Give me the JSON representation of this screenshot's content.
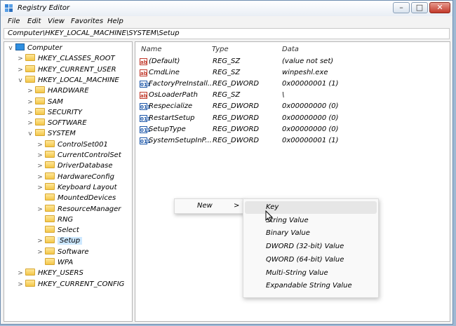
{
  "window": {
    "title": "Registry Editor"
  },
  "controls": {
    "minimize": "–",
    "maximize": "□",
    "close": "✕"
  },
  "menu": [
    "File",
    "Edit",
    "View",
    "Favorites",
    "Help"
  ],
  "address": "Computer\\HKEY_LOCAL_MACHINE\\SYSTEM\\Setup",
  "tree": [
    {
      "label": "Computer",
      "chevron": "v"
    },
    {
      "label": "HKEY_CLASSES_ROOT",
      "chevron": ">"
    },
    {
      "label": "HKEY_CURRENT_USER",
      "chevron": ">"
    },
    {
      "label": "HKEY_LOCAL_MACHINE",
      "chevron": "v"
    },
    {
      "label": "HARDWARE",
      "chevron": ">"
    },
    {
      "label": "SAM",
      "chevron": ">"
    },
    {
      "label": "SECURITY",
      "chevron": ">"
    },
    {
      "label": "SOFTWARE",
      "chevron": ">"
    },
    {
      "label": "SYSTEM",
      "chevron": "v"
    },
    {
      "label": "ControlSet001",
      "chevron": ">"
    },
    {
      "label": "CurrentControlSet",
      "chevron": ">"
    },
    {
      "label": "DriverDatabase",
      "chevron": ">"
    },
    {
      "label": "HardwareConfig",
      "chevron": ">"
    },
    {
      "label": "Keyboard Layout",
      "chevron": ">"
    },
    {
      "label": "MountedDevices",
      "chevron": ""
    },
    {
      "label": "ResourceManager",
      "chevron": ">"
    },
    {
      "label": "RNG",
      "chevron": ""
    },
    {
      "label": "Select",
      "chevron": ""
    },
    {
      "label": "Setup",
      "chevron": ">",
      "selected": true
    },
    {
      "label": "Software",
      "chevron": ">"
    },
    {
      "label": "WPA",
      "chevron": ""
    },
    {
      "label": "HKEY_USERS",
      "chevron": ">"
    },
    {
      "label": "HKEY_CURRENT_CONFIG",
      "chevron": ">"
    }
  ],
  "columns": {
    "name": "Name",
    "type": "Type",
    "data": "Data"
  },
  "values": [
    {
      "icon": "string-value-icon",
      "glyph": "ab",
      "name": "(Default)",
      "type": "REG_SZ",
      "data": "(value not set)"
    },
    {
      "icon": "string-value-icon",
      "glyph": "ab",
      "name": "CmdLine",
      "type": "REG_SZ",
      "data": "winpeshl.exe"
    },
    {
      "icon": "binary-value-icon",
      "glyph": "011",
      "name": "FactoryPreInstall...",
      "type": "REG_DWORD",
      "data": "0x00000001 (1)"
    },
    {
      "icon": "string-value-icon",
      "glyph": "ab",
      "name": "OsLoaderPath",
      "type": "REG_SZ",
      "data": "\\"
    },
    {
      "icon": "binary-value-icon",
      "glyph": "011",
      "name": "Respecialize",
      "type": "REG_DWORD",
      "data": "0x00000000 (0)"
    },
    {
      "icon": "binary-value-icon",
      "glyph": "011",
      "name": "RestartSetup",
      "type": "REG_DWORD",
      "data": "0x00000000 (0)"
    },
    {
      "icon": "binary-value-icon",
      "glyph": "011",
      "name": "SetupType",
      "type": "REG_DWORD",
      "data": "0x00000000 (0)"
    },
    {
      "icon": "binary-value-icon",
      "glyph": "011",
      "name": "SystemSetupInP...",
      "type": "REG_DWORD",
      "data": "0x00000001 (1)"
    }
  ],
  "context_menu": {
    "new_label": "New",
    "arrow": ">"
  },
  "submenu": [
    "Key",
    "String Value",
    "Binary Value",
    "DWORD (32-bit) Value",
    "QWORD (64-bit) Value",
    "Multi-String Value",
    "Expandable String Value"
  ]
}
